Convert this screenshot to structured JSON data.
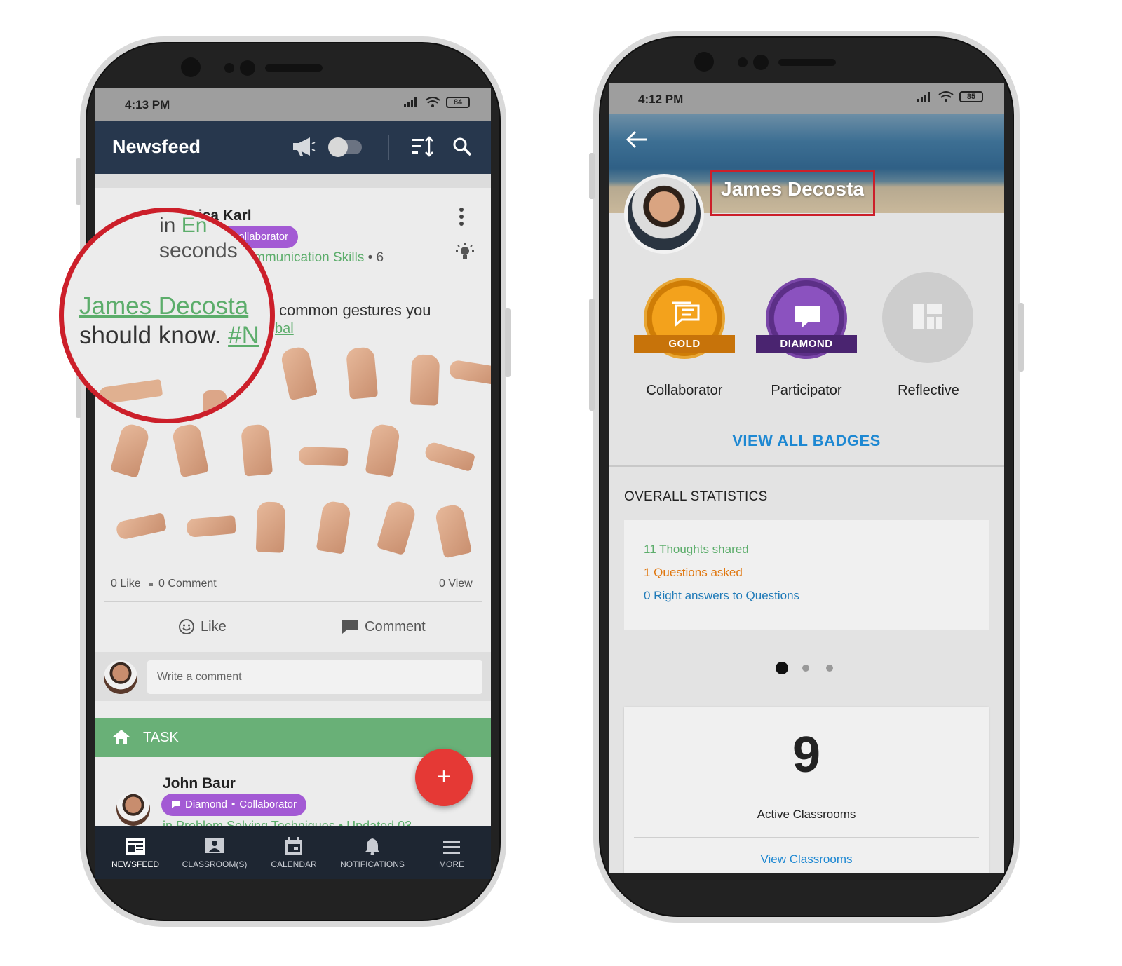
{
  "left_phone": {
    "status": {
      "time": "4:13 PM",
      "battery": "84"
    },
    "header": {
      "title": "Newsfeed"
    },
    "post1": {
      "author": "Jessica Karl",
      "badge_role": "Collaborator",
      "in_prefix": "in",
      "in_partial": "En",
      "time_partial": "seconds",
      "category": "mmunication Skills",
      "category_suffix": "• 6",
      "mention": "James Decosta",
      "text_partial": "common gestures you",
      "text_line2": "should know.",
      "hashtag": "#N",
      "hashtag_tail": "bal",
      "likes": "0 Like",
      "comments": "0 Comment",
      "views": "0 View",
      "like_label": "Like",
      "comment_label": "Comment",
      "comment_placeholder": "Write a comment"
    },
    "task": {
      "label": "TASK"
    },
    "post2": {
      "author": "John Baur",
      "badge_level": "Diamond",
      "badge_role": "Collaborator",
      "meta_partial": "in Problem Solving Techniques • Updated 03"
    },
    "fab": {
      "label": "+"
    },
    "nav": [
      "NEWSFEED",
      "CLASSROOM(S)",
      "CALENDAR",
      "NOTIFICATIONS",
      "MORE"
    ]
  },
  "right_phone": {
    "status": {
      "time": "4:12 PM",
      "battery": "85"
    },
    "profile": {
      "name": "James Decosta"
    },
    "badges": [
      {
        "level": "GOLD",
        "name": "Collaborator",
        "color": "#e0900e"
      },
      {
        "level": "DIAMOND",
        "name": "Participator",
        "color": "#6a3c9c"
      },
      {
        "level": "",
        "name": "Reflective",
        "color": "#c8c8c8"
      }
    ],
    "view_all_badges": "VIEW ALL BADGES",
    "stats": {
      "title": "OVERALL STATISTICS",
      "thoughts": "11 Thoughts shared",
      "questions": "1 Questions asked",
      "answers": "0 Right answers to Questions"
    },
    "classrooms": {
      "count": "9",
      "label": "Active Classrooms",
      "link": "View Classrooms"
    }
  },
  "colors": {
    "accent_green": "#5cad6b",
    "purple_badge": "#a35ad4",
    "link_blue": "#1e88d2",
    "header_navy": "#27374d",
    "highlight_red": "#cc1f2a",
    "fab_red": "#e53935"
  }
}
